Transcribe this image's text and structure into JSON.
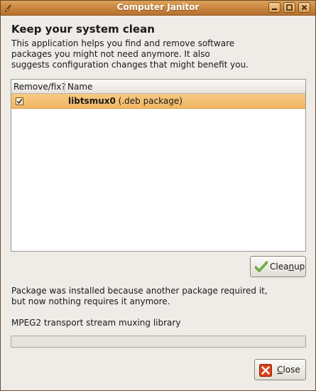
{
  "window": {
    "title": "Computer Janitor"
  },
  "intro": {
    "heading": "Keep your system clean",
    "description_line1": "This application helps you find and remove software",
    "description_line2": "packages you might not need anymore. It also",
    "description_line3": "suggests configuration changes that might benefit you."
  },
  "list": {
    "columns": [
      "Remove/fix?",
      "Name"
    ],
    "rows": [
      {
        "checked": true,
        "name": "libtsmux0",
        "type": "(.deb package)",
        "selected": true
      }
    ]
  },
  "buttons": {
    "cleanup_pre": "Clea",
    "cleanup_mnemonic": "n",
    "cleanup_post": "up",
    "close_mnemonic": "C",
    "close_post": "lose"
  },
  "details": {
    "reason_line1": "Package was installed because another package required it,",
    "reason_line2": "but now nothing requires it anymore.",
    "summary": "MPEG2 transport stream muxing library"
  },
  "progress": {
    "fraction": 0
  },
  "colors": {
    "titlebar": "#c7833c",
    "selection": "#f0b765",
    "window_bg": "#efebe7"
  },
  "icons": {
    "app": "janitor-broom-icon",
    "cleanup": "check-icon",
    "close": "close-icon"
  }
}
